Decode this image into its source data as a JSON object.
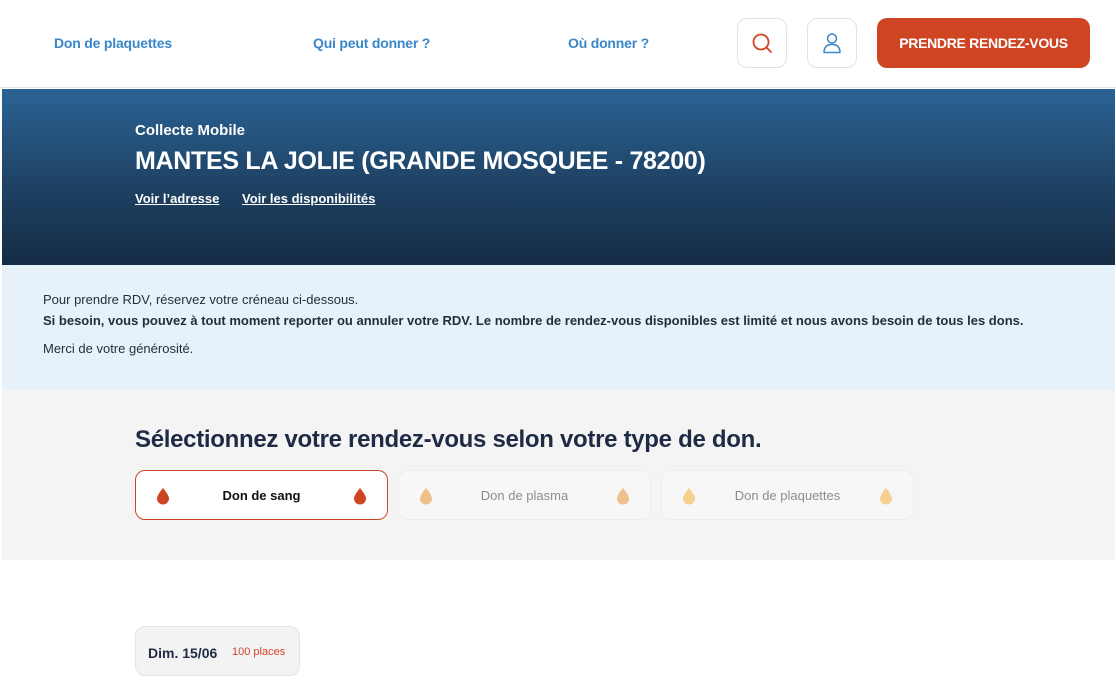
{
  "nav": {
    "links": [
      "Don de plaquettes",
      "Qui peut donner ?",
      "Où donner ?"
    ],
    "search_icon": "search-icon",
    "user_icon": "user-icon",
    "cta_label": "PRENDRE RENDEZ-VOUS"
  },
  "hero": {
    "kicker": "Collecte Mobile",
    "title": "MANTES LA JOLIE (GRANDE MOSQUEE - 78200)",
    "links": [
      "Voir l’adresse",
      "Voir les disponibilités"
    ]
  },
  "info": {
    "line1": "Pour prendre RDV, réservez votre créneau ci-dessous.",
    "line2": "Si besoin, vous pouvez à tout moment reporter ou annuler votre RDV. Le nombre de rendez-vous disponibles est limité et nous avons besoin de tous les dons.",
    "line3": "Merci de votre générosité."
  },
  "selection": {
    "title": "Sélectionnez votre rendez-vous selon votre type de don.",
    "options": [
      {
        "label": "Don de sang",
        "active": true
      },
      {
        "label": "Don de plasma",
        "active": false
      },
      {
        "label": "Don de plaquettes",
        "active": false
      }
    ]
  },
  "slots": [
    {
      "date": "Dim. 15/06",
      "places": "100 places"
    }
  ],
  "colors": {
    "accent": "#cf4524",
    "link_blue": "#3a86c8",
    "drop_active": "#cf4524",
    "drop_inactive": "#f0c08a"
  }
}
